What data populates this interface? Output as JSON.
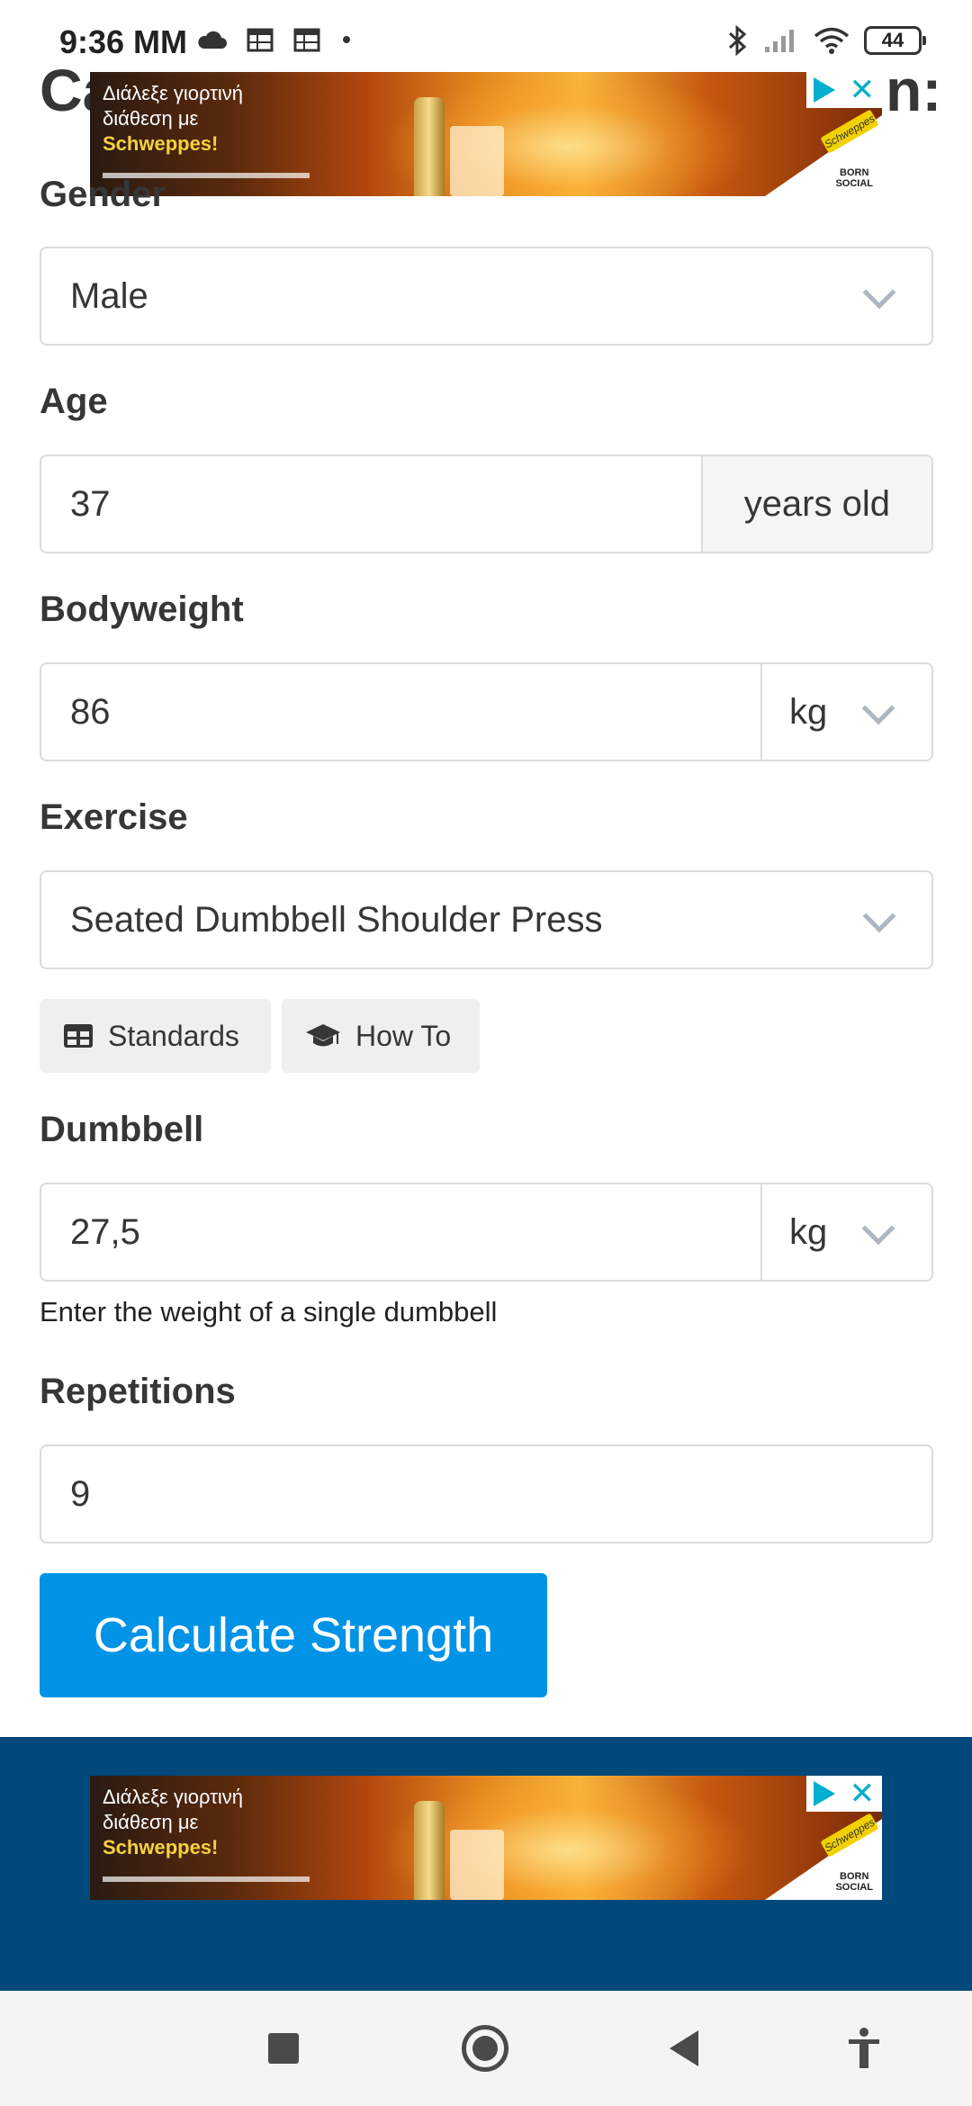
{
  "status_bar": {
    "time": "9:36 MM",
    "battery": "44",
    "left_icons": [
      "cloud-icon",
      "calendar-icon",
      "calendar-icon",
      "dot-icon"
    ],
    "right_icons": [
      "bluetooth-icon",
      "signal-icon",
      "wifi-icon",
      "battery-icon"
    ]
  },
  "page": {
    "title_start": "Ca",
    "title_end": "n:"
  },
  "ad": {
    "line1": "Διάλεξε γιορτινή",
    "line2": "διάθεση με",
    "brand": "Schweppes!",
    "logo": "Schweppes",
    "slogan_line1": "BORN",
    "slogan_line2": "SOCIAL"
  },
  "form": {
    "gender": {
      "label": "Gender",
      "value": "Male"
    },
    "age": {
      "label": "Age",
      "value": "37",
      "addon": "years old"
    },
    "bodyweight": {
      "label": "Bodyweight",
      "value": "86",
      "unit": "kg"
    },
    "exercise": {
      "label": "Exercise",
      "value": "Seated Dumbbell Shoulder Press"
    },
    "buttons": {
      "standards": "Standards",
      "how_to": "How To"
    },
    "dumbbell": {
      "label": "Dumbbell",
      "value": "27,5",
      "unit": "kg",
      "help": "Enter the weight of a single dumbbell"
    },
    "repetitions": {
      "label": "Repetitions",
      "value": "9"
    },
    "submit": "Calculate Strength"
  },
  "colors": {
    "primary_button": "#0093e6",
    "footer_band": "#00497a",
    "ad_choices": "#00aecd"
  },
  "nav_bar": {
    "icons": [
      "recents-square-icon",
      "home-circle-icon",
      "back-triangle-icon",
      "accessibility-icon"
    ]
  }
}
